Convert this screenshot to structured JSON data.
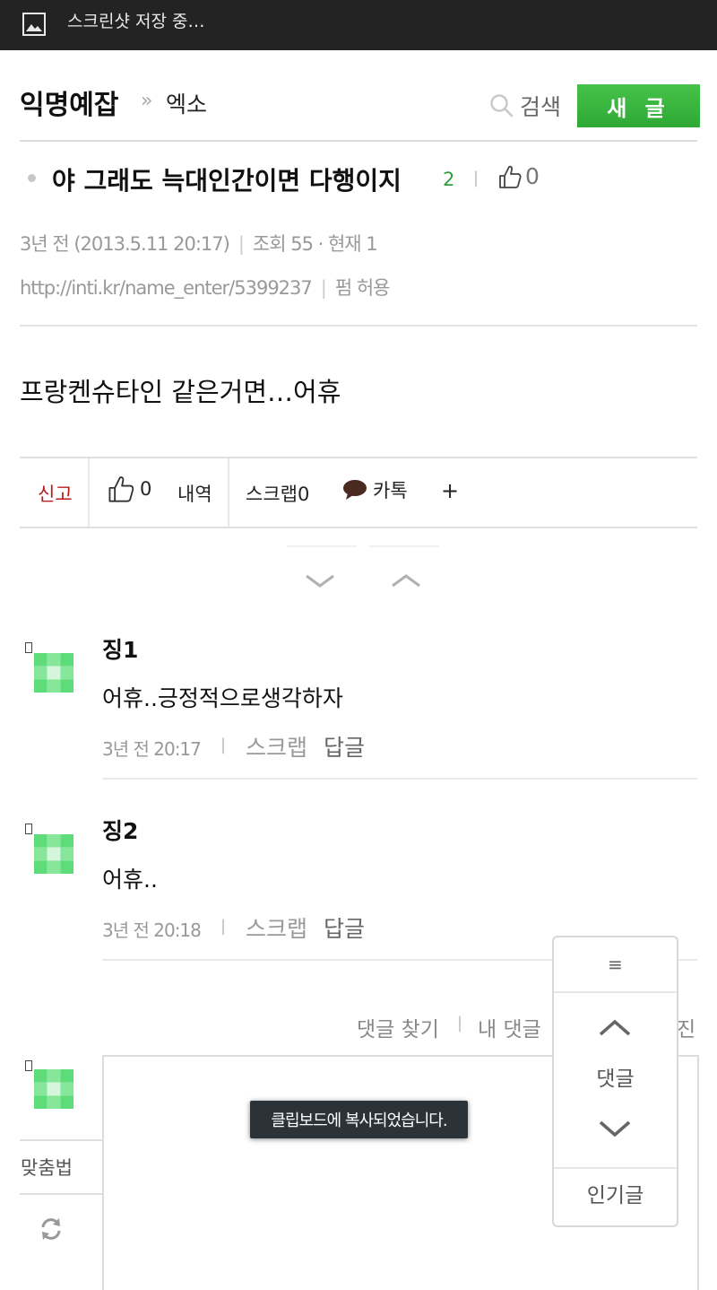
{
  "status_bar": {
    "text": "스크린샷 저장 중…"
  },
  "header": {
    "brand": "익명예잡",
    "separator": "»",
    "board": "엑소",
    "search_label": "검색",
    "new_post_label": "새 글"
  },
  "post": {
    "title": "야 그래도 늑대인간이면 다행이지",
    "comment_count": "2",
    "likes": "0",
    "time": "3년 전 (2013.5.11 20:17)",
    "views": "조회 55 · 현재 1",
    "url": "http://inti.kr/name_enter/5399237",
    "permission": "펌 허용",
    "body": "프랑켄슈타인 같은거면…어휴"
  },
  "actions": {
    "report": "신고",
    "likes": "0",
    "history": "내역",
    "scrap": "스크랩0",
    "kakao": "카톡",
    "more": "+"
  },
  "comments": [
    {
      "name": "징1",
      "text": "어휴..긍정적으로생각하자",
      "time": "3년 전 20:17",
      "scrap": "스크랩",
      "reply": "답글"
    },
    {
      "name": "징2",
      "text": "어휴..",
      "time": "3년 전 20:18",
      "scrap": "스크랩",
      "reply": "답글"
    }
  ],
  "comment_tools": {
    "find": "댓글 찾기",
    "my": "내 댓글",
    "clipped": "진"
  },
  "compose": {
    "spellcheck": "맞춤법"
  },
  "toast": {
    "text": "클립보드에 복사되었습니다."
  },
  "floating_panel": {
    "menu": "≡",
    "label": "댓글",
    "popular": "인기글"
  },
  "colors": {
    "green": "#3bb33f",
    "report_red": "#b71c1c",
    "count_green": "#2e9e3b"
  },
  "icons": [
    "image-icon",
    "search-icon",
    "thumbs-up-icon",
    "speech-bubble-icon",
    "chevron-down-icon",
    "chevron-up-icon",
    "refresh-icon"
  ]
}
